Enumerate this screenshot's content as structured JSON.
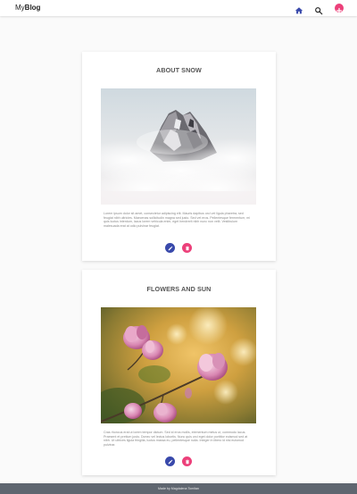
{
  "header": {
    "brand_part1": "My",
    "brand_part2": "Blog",
    "icons": [
      "home-icon",
      "search-icon",
      "add-icon"
    ]
  },
  "posts": [
    {
      "title": "ABOUT SNOW",
      "image_subject": "snowy mountain peak above clouds",
      "body": "Lorem ipsum dolor sit amet, consectetur adipiscing elit. Mauris dapibus orci vel ligula pharetra, sed feugiat nibh ultricies. Maecenas sollicitudin magna sed justo. Sed vel eros. Pellentesque fermentum, mi quis luctus interdum, lacus lorem vehicula enim, eget hendrerit nibh nunc non velit. Vestibulum malesuada erat at odio pulvinar feugiat.",
      "actions": [
        "edit-icon",
        "delete-icon"
      ]
    },
    {
      "title": "FLOWERS AND SUN",
      "image_subject": "pink magnolia flowers in sunlight",
      "body": "Cras rhoncus erat ut lorem tempor dictum. Sed id eros mollis, elementum metus ut, commodo lacus. Praesent et pretium justo. Donec vel lectus lobortis. Nunc quis orci eget dolor porttitor euismod sed at nibh. Ut ultrices ligula fringilla, luctus massa eu, pellentesque nulla. Integer in libero id nisi euismod pulvinar.",
      "actions": [
        "edit-icon",
        "delete-icon"
      ]
    }
  ],
  "footer": {
    "text": "Made by Magdalena Tomitan"
  },
  "colors": {
    "primary": "#3949ab",
    "accent": "#ec407a",
    "footer_bg": "#5f6670"
  }
}
